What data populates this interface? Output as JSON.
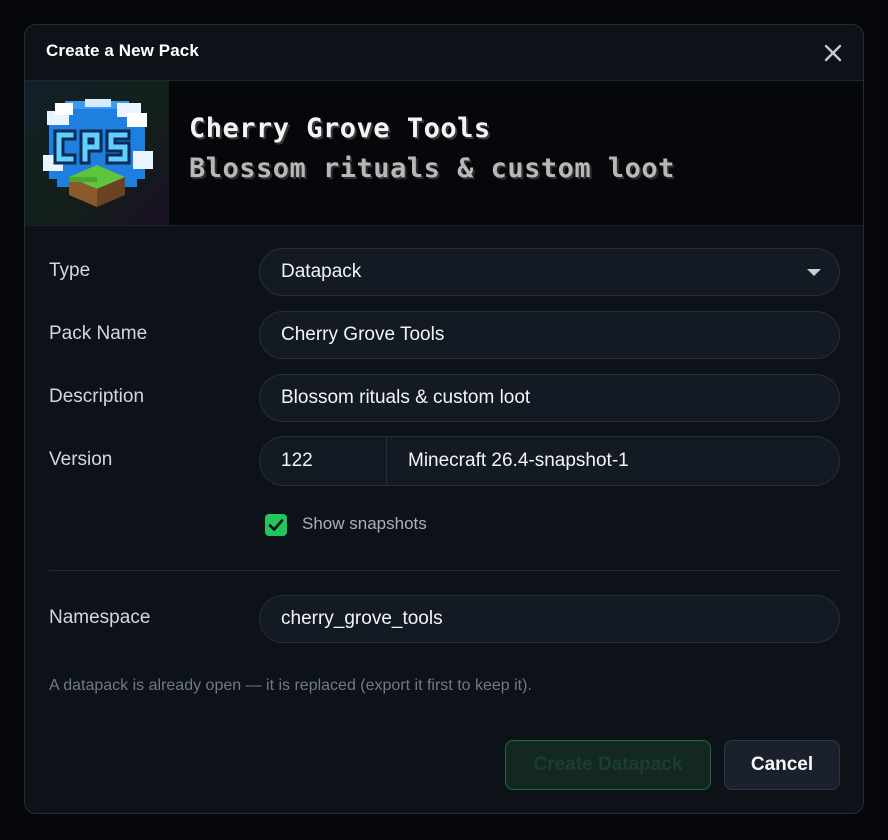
{
  "dialog": {
    "title": "Create a New Pack",
    "close_icon": "close-icon"
  },
  "banner": {
    "logo_icon": "pack-logo-icon",
    "logo_text": "CPS",
    "title": "Cherry Grove Tools",
    "subtitle": "Blossom rituals & custom loot"
  },
  "form": {
    "type": {
      "label": "Type",
      "value": "Datapack",
      "icon": "chevron-down-icon"
    },
    "pack_name": {
      "label": "Pack Name",
      "value": "Cherry Grove Tools"
    },
    "description": {
      "label": "Description",
      "value": "Blossom rituals & custom loot"
    },
    "version": {
      "label": "Version",
      "number": "122",
      "name": "Minecraft 26.4-snapshot-1"
    },
    "show_snapshots": {
      "label": "Show snapshots",
      "checked": true,
      "icon": "checkmark-icon"
    },
    "namespace": {
      "label": "Namespace",
      "value": "cherry_grove_tools"
    }
  },
  "note": "A datapack is already open — it is replaced (export it first to keep it).",
  "buttons": {
    "create": "Create Datapack",
    "cancel": "Cancel"
  },
  "colors": {
    "accent": "#22c55e",
    "background": "#0d1118",
    "field": "#141a23"
  }
}
